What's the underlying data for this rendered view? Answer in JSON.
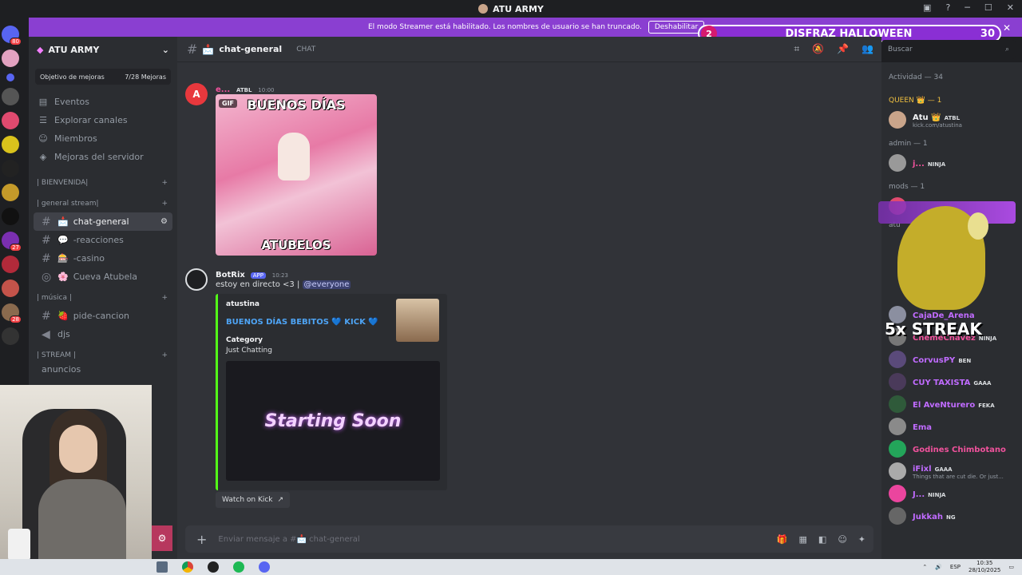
{
  "window": {
    "title": "ATU ARMY"
  },
  "streamer_bar": {
    "text": "El modo Streamer está habilitado. Los nombres de usuario se han truncado.",
    "button": "Deshabilitar"
  },
  "halloween": {
    "number": "2",
    "label": "DISFRAZ HALLOWEEN",
    "count": "30"
  },
  "server_badges": [
    "80",
    "27",
    "28"
  ],
  "guild": {
    "name": "ATU ARMY",
    "boost_label": "Objetivo de mejoras",
    "boost_value": "7/28 Mejoras",
    "nav": [
      "Eventos",
      "Explorar canales",
      "Miembros",
      "Mejoras del servidor"
    ]
  },
  "categories": {
    "bienvenida": "| BIENVENIDA|",
    "general_stream": "| general stream|",
    "musica": "| música |",
    "stream": "| STREAM |",
    "anuncios": "anuncios"
  },
  "channels": [
    {
      "name": "chat-general",
      "emoji": "📩"
    },
    {
      "name": "-reacciones",
      "emoji": "💬"
    },
    {
      "name": "-casino",
      "emoji": "🎰"
    },
    {
      "name": "Cueva Atubela",
      "emoji": "🌸"
    },
    {
      "name": "pide-cancion",
      "emoji": "🍓"
    },
    {
      "name": "djs",
      "emoji": ""
    }
  ],
  "chat": {
    "channel": "chat-general",
    "topic": "CHAT",
    "message1": {
      "user": "e...",
      "role": "ATBL",
      "time": "10:00",
      "gif_tag": "GIF",
      "gif_top": "BUENOS DÍAS",
      "gif_bottom": "ATUBELOS"
    },
    "message2": {
      "user": "BotRix",
      "app_tag": "APP",
      "time": "10:23",
      "text": "estoy en directo <3 |",
      "mention": "@everyone",
      "embed_author": "atustina",
      "embed_title": "BUENOS DÍAS BEBITOS 💙 KICK 💙",
      "field_name": "Category",
      "field_value": "Just Chatting",
      "image_text": "Starting Soon",
      "button": "Watch on Kick"
    },
    "input_placeholder": "Enviar mensaje a #📩 chat-general"
  },
  "search": {
    "placeholder": "Buscar"
  },
  "members": {
    "activity": "Actividad — 34",
    "groups": [
      {
        "label": "QUEEN 👑 — 1",
        "items": [
          {
            "name": "Atu 👑",
            "tag": "ATBL",
            "sub": "kick.com/atustina",
            "color": "#f2f3f5"
          }
        ]
      },
      {
        "label": "admin — 1",
        "items": [
          {
            "name": "j...",
            "tag": "NINJA",
            "sub": "",
            "color": "#f0529c"
          }
        ]
      },
      {
        "label": "mods — 1",
        "items": []
      },
      {
        "label": "atu",
        "items": [
          {
            "name": "CajaDe_Arena",
            "tag": "",
            "sub": "",
            "color": "#c06bff"
          },
          {
            "name": "ChemeChavez",
            "tag": "NINJA",
            "sub": "",
            "color": "#f0529c"
          },
          {
            "name": "CorvusPY",
            "tag": "BEN",
            "sub": "",
            "color": "#c06bff"
          },
          {
            "name": "CUY TAXISTA",
            "tag": "GAAA",
            "sub": "",
            "color": "#c06bff"
          },
          {
            "name": "El AveNturero",
            "tag": "FEKA",
            "sub": "",
            "color": "#c06bff"
          },
          {
            "name": "Ema",
            "tag": "",
            "sub": "",
            "color": "#c06bff"
          },
          {
            "name": "Godines Chimbotano",
            "tag": "",
            "sub": "",
            "color": "#f0529c"
          },
          {
            "name": "iFixl",
            "tag": "GAAA",
            "sub": "Things that are cut die. Or just...",
            "color": "#c06bff"
          },
          {
            "name": "J...",
            "tag": "NINJA",
            "sub": "",
            "color": "#c06bff"
          },
          {
            "name": "Jukkah",
            "tag": "NG",
            "sub": "",
            "color": "#c06bff"
          }
        ]
      }
    ],
    "streak": "5x STREAK"
  },
  "taskbar": {
    "lang": "ESP",
    "time": "10:35",
    "date": "28/10/2025"
  }
}
